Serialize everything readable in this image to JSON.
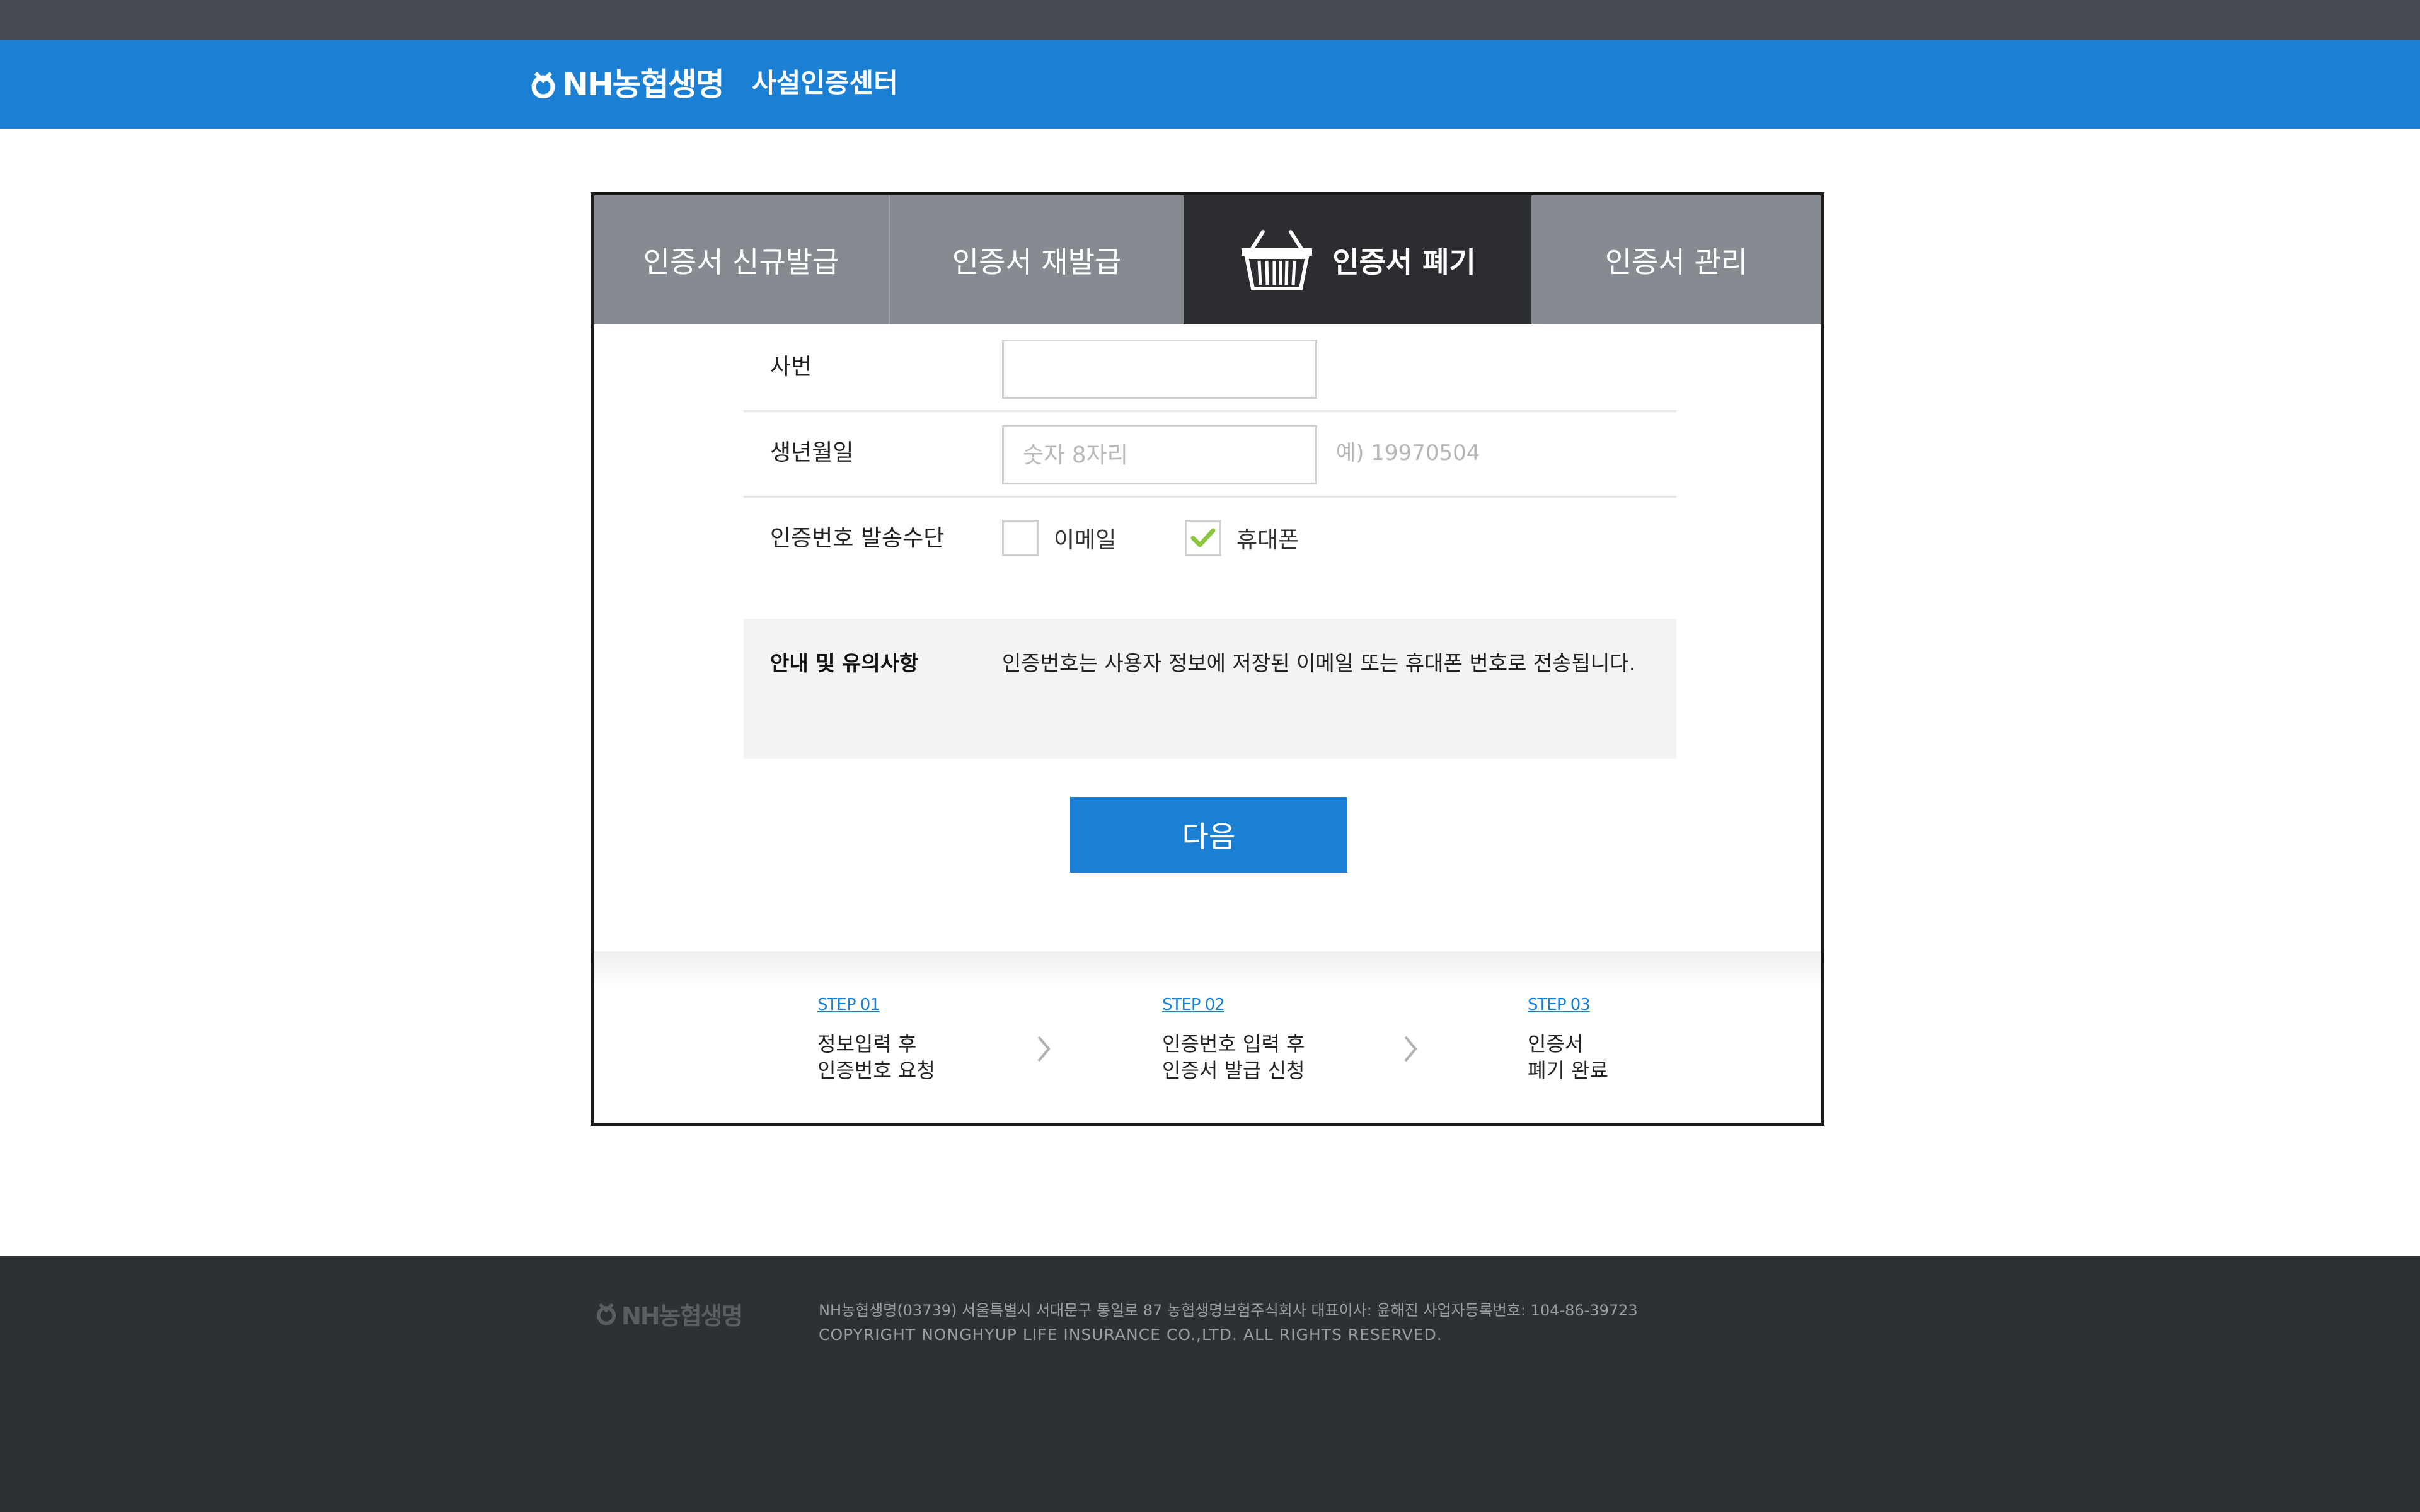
{
  "header": {
    "logo_text": "NH농협생명",
    "title": "사설인증센터"
  },
  "tabs": [
    {
      "label": "인증서 신규발급",
      "active": false
    },
    {
      "label": "인증서 재발급",
      "active": false
    },
    {
      "label": "인증서 폐기",
      "active": true,
      "icon": "basket-icon"
    },
    {
      "label": "인증서 관리",
      "active": false
    }
  ],
  "form": {
    "employee_id": {
      "label": "사번",
      "value": "",
      "placeholder": ""
    },
    "birthdate": {
      "label": "생년월일",
      "value": "",
      "placeholder": "숫자 8자리",
      "hint": "예) 19970504"
    },
    "send_method": {
      "label": "인증번호 발송수단",
      "options": [
        {
          "label": "이메일",
          "checked": false
        },
        {
          "label": "휴대폰",
          "checked": true
        }
      ]
    }
  },
  "notice": {
    "title": "안내 및 유의사항",
    "text": "인증번호는 사용자 정보에 저장된 이메일 또는 휴대폰 번호로 전송됩니다."
  },
  "next_button": "다음",
  "steps": [
    {
      "number": "STEP 01",
      "line1": "정보입력 후",
      "line2": "인증번호 요청"
    },
    {
      "number": "STEP 02",
      "line1": "인증번호 입력 후",
      "line2": "인증서 발급 신청"
    },
    {
      "number": "STEP 03",
      "line1": "인증서",
      "line2": "폐기 완료"
    }
  ],
  "footer": {
    "logo_text": "NH농협생명",
    "address": "NH농협생명(03739) 서울특별시 서대문구 통일로 87 농협생명보험주식회사 대표이사: 윤해진 사업자등록번호: 104-86-39723",
    "copyright": "COPYRIGHT NONGHYUP LIFE INSURANCE CO.,LTD. ALL RIGHTS RESERVED."
  },
  "colors": {
    "brand_blue": "#1b7fd4",
    "active_tab": "#2b2d30",
    "inactive_tab": "#858b91",
    "check_green": "#8cc63f"
  }
}
